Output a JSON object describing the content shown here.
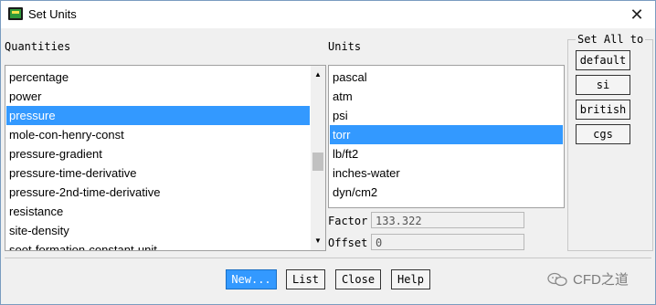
{
  "window": {
    "title": "Set Units",
    "close_glyph": "✕"
  },
  "quantities": {
    "label": "Quantities",
    "items": [
      {
        "label": "percentage",
        "selected": false
      },
      {
        "label": "power",
        "selected": false
      },
      {
        "label": "pressure",
        "selected": true
      },
      {
        "label": "mole-con-henry-const",
        "selected": false
      },
      {
        "label": "pressure-gradient",
        "selected": false
      },
      {
        "label": "pressure-time-derivative",
        "selected": false
      },
      {
        "label": "pressure-2nd-time-derivative",
        "selected": false
      },
      {
        "label": "resistance",
        "selected": false
      },
      {
        "label": "site-density",
        "selected": false
      },
      {
        "label": "soot-formation-constant-unit",
        "selected": false
      }
    ]
  },
  "units": {
    "label": "Units",
    "items": [
      {
        "label": "pascal",
        "selected": false
      },
      {
        "label": "atm",
        "selected": false
      },
      {
        "label": "psi",
        "selected": false
      },
      {
        "label": "torr",
        "selected": true
      },
      {
        "label": "lb/ft2",
        "selected": false
      },
      {
        "label": "inches-water",
        "selected": false
      },
      {
        "label": "dyn/cm2",
        "selected": false
      }
    ]
  },
  "factor": {
    "label": "Factor",
    "value": "133.322"
  },
  "offset": {
    "label": "Offset",
    "value": "0"
  },
  "set_all": {
    "legend": "Set All to",
    "buttons": [
      "default",
      "si",
      "british",
      "cgs"
    ]
  },
  "actions": {
    "new": "New...",
    "list": "List",
    "close": "Close",
    "help": "Help"
  },
  "watermark": {
    "text": "CFD之道"
  },
  "colors": {
    "selection": "#3399ff",
    "window_bg": "#f0f0f0"
  }
}
